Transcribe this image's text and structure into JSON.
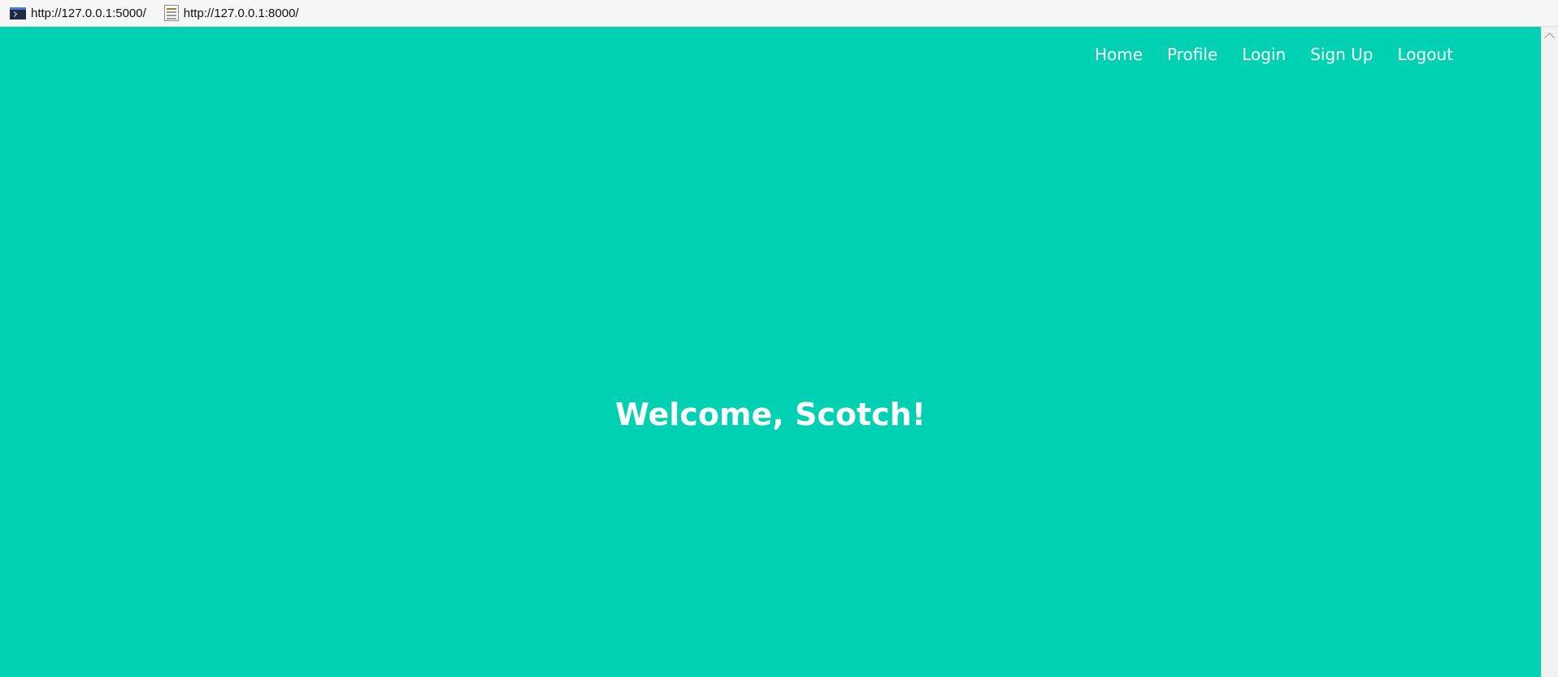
{
  "bookmarks": [
    {
      "label": "http://127.0.0.1:5000/",
      "icon": "terminal-icon"
    },
    {
      "label": "http://127.0.0.1:8000/",
      "icon": "page-icon"
    }
  ],
  "nav": {
    "items": [
      "Home",
      "Profile",
      "Login",
      "Sign Up",
      "Logout"
    ]
  },
  "hero": {
    "title": "Welcome, Scotch!"
  },
  "colors": {
    "background": "#00d1b2",
    "text": "#ffffff"
  }
}
